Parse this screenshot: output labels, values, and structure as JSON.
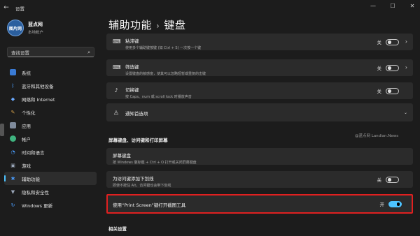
{
  "window": {
    "back_glyph": "←",
    "app_title": "设置",
    "controls": [
      "—",
      "☐",
      "✕"
    ]
  },
  "profile": {
    "avatar_text": "图片网",
    "name": "蓝点网",
    "subtitle": "本地帐户"
  },
  "search": {
    "placeholder": "查找设置",
    "icon": "search-icon"
  },
  "nav": {
    "items": [
      {
        "label": "系统",
        "icon": "system-icon",
        "color": "#4a9eff"
      },
      {
        "label": "蓝牙和其他设备",
        "icon": "bluetooth-icon",
        "color": "#4a9eff"
      },
      {
        "label": "网络和 Internet",
        "icon": "network-icon",
        "color": "#6aa9ff"
      },
      {
        "label": "个性化",
        "icon": "personalization-icon",
        "color": "#d6a14a"
      },
      {
        "label": "应用",
        "icon": "apps-icon",
        "color": "#9aa6b8"
      },
      {
        "label": "帐户",
        "icon": "accounts-icon",
        "color": "#3fb37f"
      },
      {
        "label": "时间和语言",
        "icon": "time-language-icon",
        "color": "#4a9eff"
      },
      {
        "label": "游戏",
        "icon": "gaming-icon",
        "color": "#9aa6b8"
      },
      {
        "label": "辅助功能",
        "icon": "accessibility-icon",
        "color": "#4a9eff"
      },
      {
        "label": "隐私和安全性",
        "icon": "privacy-icon",
        "color": "#9aa6b8"
      },
      {
        "label": "Windows 更新",
        "icon": "windows-update-icon",
        "color": "#4a9eff"
      }
    ],
    "active_index": 8
  },
  "page": {
    "parent": "辅助功能",
    "separator": "›",
    "current": "键盘"
  },
  "settings": {
    "sticky_keys": {
      "title": "粘滞键",
      "desc": "使用多个辅助键按键 (如 Ctrl + S) 一次按一个键",
      "state": "关",
      "on": false
    },
    "filter_keys": {
      "title": "筛选键",
      "desc": "设置键盘的敏感度，使其可以忽略短暂或重复的击键",
      "state": "关",
      "on": false
    },
    "toggle_keys": {
      "title": "切换键",
      "desc": "按 Caps、num 或 scroll lock 时播放声音",
      "state": "关",
      "on": false
    },
    "notifications": {
      "title": "通知首选项"
    }
  },
  "section_onscreen": {
    "heading": "屏幕键盘、访问键和打印屏幕",
    "onscreen_keyboard": {
      "title": "屏幕键盘",
      "desc": "按 Windows 徽标键 + Ctrl + O 打开或关闭屏幕键盘"
    },
    "underline_access_keys": {
      "title": "为访问键添加下划线",
      "desc": "即使不按住 Alt，访问键也会带下划线",
      "state": "关",
      "on": false
    },
    "print_screen": {
      "title": "使用“Print Screen”键打开截图工具",
      "state": "开",
      "on": true
    }
  },
  "watermark": "@蓝点网 Landian.News",
  "related_heading": "相关设置",
  "colors": {
    "accent": "#4cc2ff",
    "highlight_border": "#e02020"
  }
}
